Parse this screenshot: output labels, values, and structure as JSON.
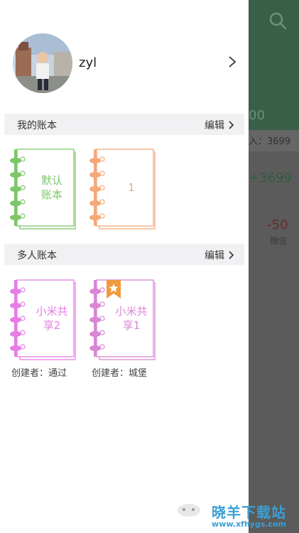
{
  "profile": {
    "username": "zyl"
  },
  "sections": [
    {
      "title": "我的账本",
      "edit_label": "编辑",
      "books": [
        {
          "title": "默认账本",
          "title_lines": [
            "默认",
            "账本"
          ],
          "color": "#7dc66a",
          "starred": false
        },
        {
          "title": "1",
          "title_lines": [
            "1"
          ],
          "color": "#f4a97a",
          "starred": false
        }
      ]
    },
    {
      "title": "多人账本",
      "edit_label": "编辑",
      "books": [
        {
          "title": "小米共享2",
          "title_lines": [
            "小米共",
            "享2"
          ],
          "color": "#e67ee6",
          "creator": "创建者：通过",
          "starred": false
        },
        {
          "title": "小米共享1",
          "title_lines": [
            "小米共",
            "享1"
          ],
          "color": "#e67ee6",
          "creator": "创建者：城堡",
          "starred": true
        }
      ]
    }
  ],
  "background_screen": {
    "amount_top": "00",
    "income_label": "入：3699",
    "income_value": "+3699",
    "expense_value": "-50",
    "expense_label": "微信"
  },
  "watermark": {
    "text": "晓羊下载站",
    "url": "www.xfhygs.com"
  },
  "colors": {
    "star_badge": "#f19a3e",
    "header_bg": "#3a5f48",
    "section_bg": "#f1f1f3"
  }
}
